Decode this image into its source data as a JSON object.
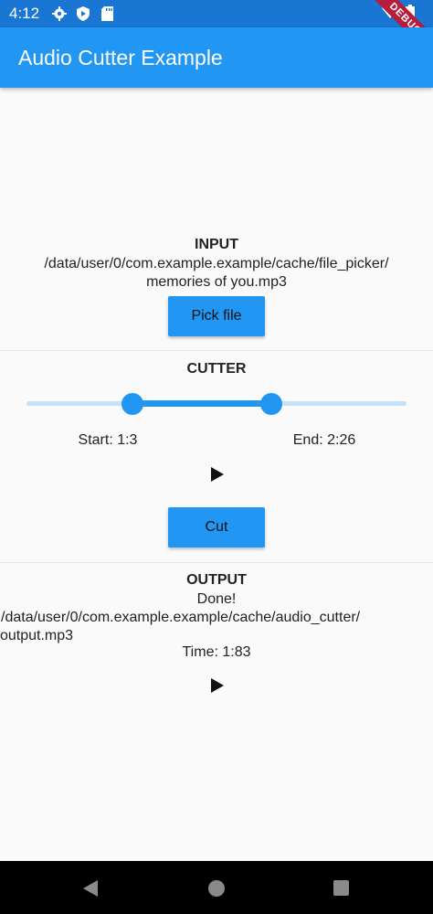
{
  "status_bar": {
    "time": "4:12",
    "icons": [
      "gear-icon",
      "shield-icon",
      "sd-card-icon",
      "wifi-icon",
      "battery-icon"
    ],
    "banner": "DEBUG"
  },
  "app_bar": {
    "title": "Audio Cutter Example"
  },
  "input": {
    "title": "INPUT",
    "path_line1": "/data/user/0/com.example.example/cache/file_picker/",
    "path_line2": "memories of you.mp3",
    "button_label": "Pick file"
  },
  "cutter": {
    "title": "CUTTER",
    "start_label": "Start: 1:3",
    "end_label": "End: 2:26",
    "range_start_fraction": 0.28,
    "range_end_fraction": 0.645,
    "button_label": "Cut"
  },
  "output": {
    "title": "OUTPUT",
    "status": "Done!",
    "path_line1": "/data/user/0/com.example.example/cache/audio_cutter/",
    "path_line2": "output.mp3",
    "time_label": "Time: 1:83"
  },
  "colors": {
    "primary": "#2196f3",
    "primary_dark": "#1976d2",
    "track_inactive": "#c5e0f8"
  }
}
